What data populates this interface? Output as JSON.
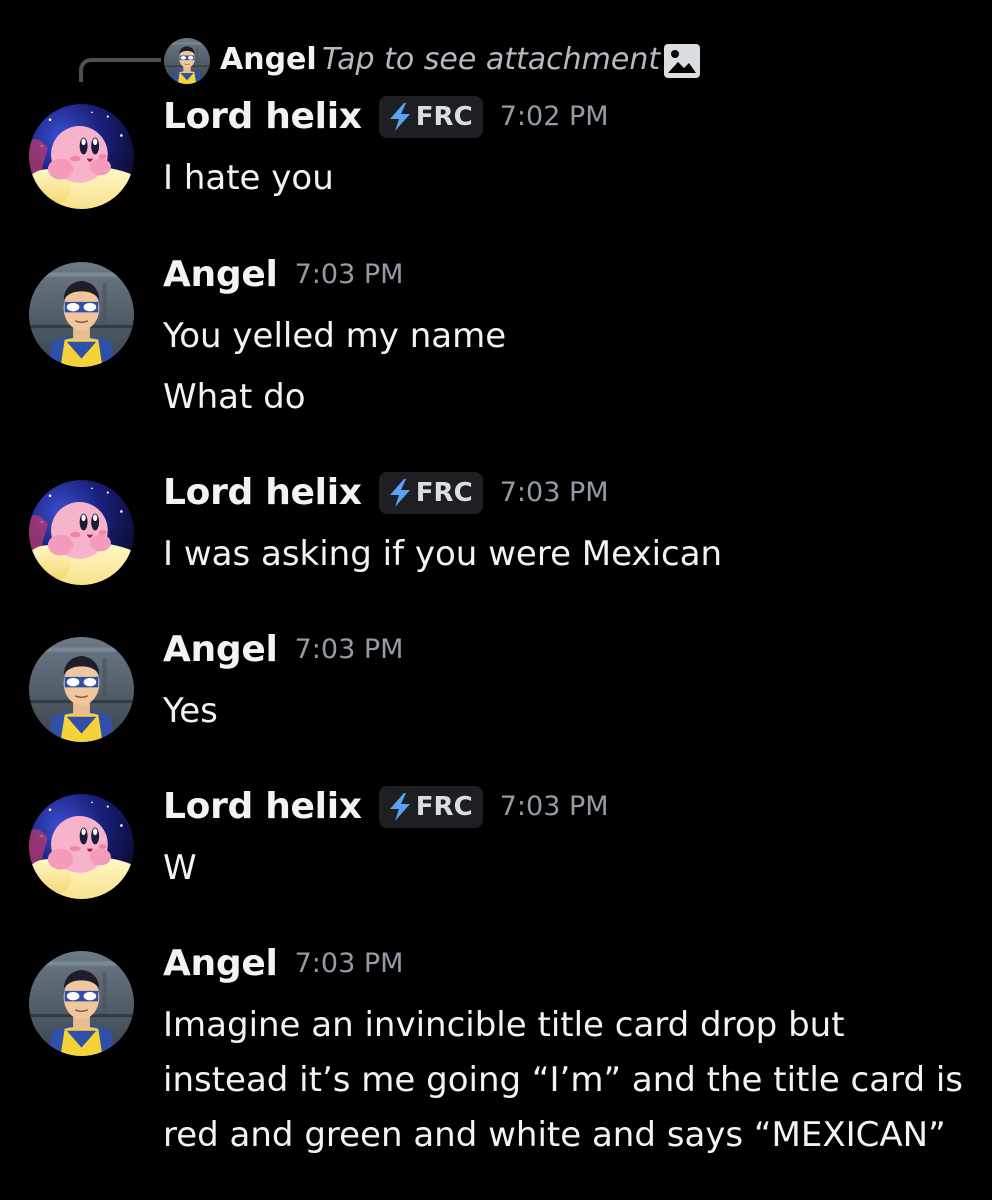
{
  "reply": {
    "author": "Angel",
    "text": "Tap to see attachment",
    "icon": "image-icon"
  },
  "colors": {
    "background": "#000000",
    "text": "#f2f3f5",
    "muted": "#949ba4",
    "tag_bg": "#1e1f22",
    "bolt": "#5aa3f0"
  },
  "messages": [
    {
      "author": "Lord helix",
      "avatar": "kirby-avatar",
      "tag": "FRC",
      "tag_icon": "lightning-bolt-icon",
      "time": "7:02 PM",
      "lines": [
        "I hate you"
      ]
    },
    {
      "author": "Angel",
      "avatar": "invincible-avatar",
      "time": "7:03 PM",
      "lines": [
        "You yelled my name",
        "What do"
      ]
    },
    {
      "author": "Lord helix",
      "avatar": "kirby-avatar",
      "tag": "FRC",
      "tag_icon": "lightning-bolt-icon",
      "time": "7:03 PM",
      "lines": [
        "I was asking if you were Mexican"
      ]
    },
    {
      "author": "Angel",
      "avatar": "invincible-avatar",
      "time": "7:03 PM",
      "lines": [
        "Yes"
      ]
    },
    {
      "author": "Lord helix",
      "avatar": "kirby-avatar",
      "tag": "FRC",
      "tag_icon": "lightning-bolt-icon",
      "time": "7:03 PM",
      "lines": [
        "W"
      ]
    },
    {
      "author": "Angel",
      "avatar": "invincible-avatar",
      "time": "7:03 PM",
      "lines": [
        "Imagine an invincible title card drop but",
        "instead it’s me going “I’m” and the title card is",
        "red and green and white and says “MEXICAN”"
      ]
    }
  ]
}
